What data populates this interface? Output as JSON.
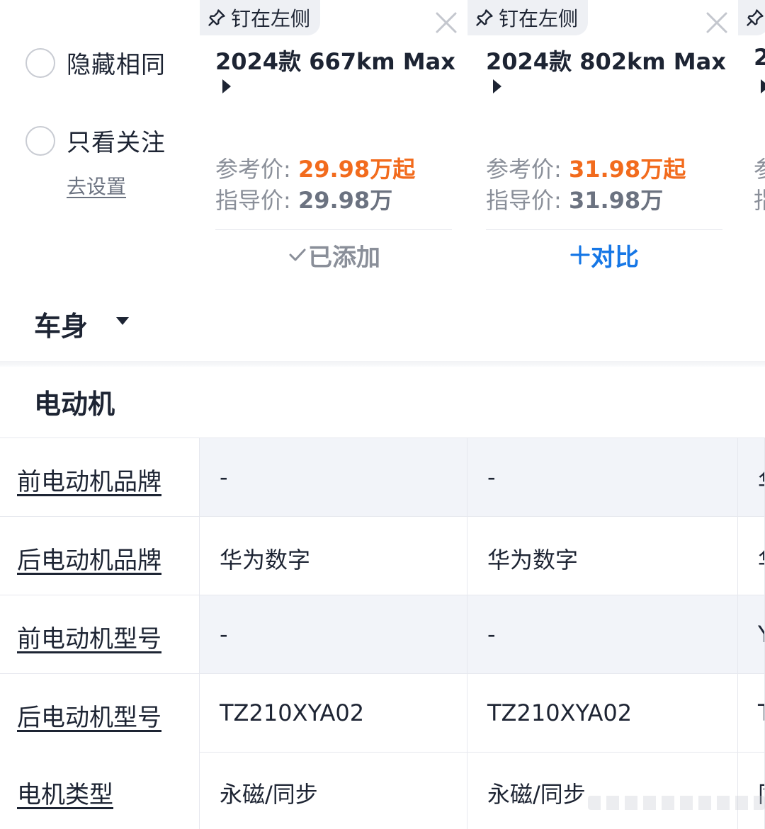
{
  "filters": {
    "hide_same": "隐藏相同",
    "only_followed": "只看关注",
    "go_settings": "去设置"
  },
  "cars": [
    {
      "pin_label": "钉在左侧",
      "name": "2024款 667km Max",
      "ref_price_label": "参考价:",
      "ref_price": "29.98万起",
      "guide_price_label": "指导价:",
      "guide_price": "29.98万",
      "action": "已添加",
      "action_state": "added"
    },
    {
      "pin_label": "钉在左侧",
      "name": "2024款 802km Max",
      "ref_price_label": "参考价:",
      "ref_price": "31.98万起",
      "guide_price_label": "指导价:",
      "guide_price": "31.98万",
      "action": "对比",
      "action_state": "compare"
    },
    {
      "pin_label": "钉在左侧",
      "name": "2",
      "ref_price_label": "参",
      "guide_price_label": "指"
    }
  ],
  "sections": {
    "body": "车身",
    "motor": "电动机"
  },
  "rows": [
    {
      "label": "前电动机品牌",
      "values": [
        "-",
        "-",
        "华"
      ]
    },
    {
      "label": "后电动机品牌",
      "values": [
        "华为数字",
        "华为数字",
        "华"
      ]
    },
    {
      "label": "前电动机型号",
      "values": [
        "-",
        "-",
        "Y"
      ]
    },
    {
      "label": "后电动机型号",
      "values": [
        "TZ210XYA02",
        "TZ210XYA02",
        "T"
      ]
    },
    {
      "label": "电机类型",
      "values": [
        "永磁/同步",
        "永磁/同步",
        "同"
      ]
    }
  ],
  "colors": {
    "accent_price": "#f26b1d",
    "accent_action": "#1677e6",
    "muted": "#8a8f99",
    "row_shade": "#f2f4f9"
  }
}
